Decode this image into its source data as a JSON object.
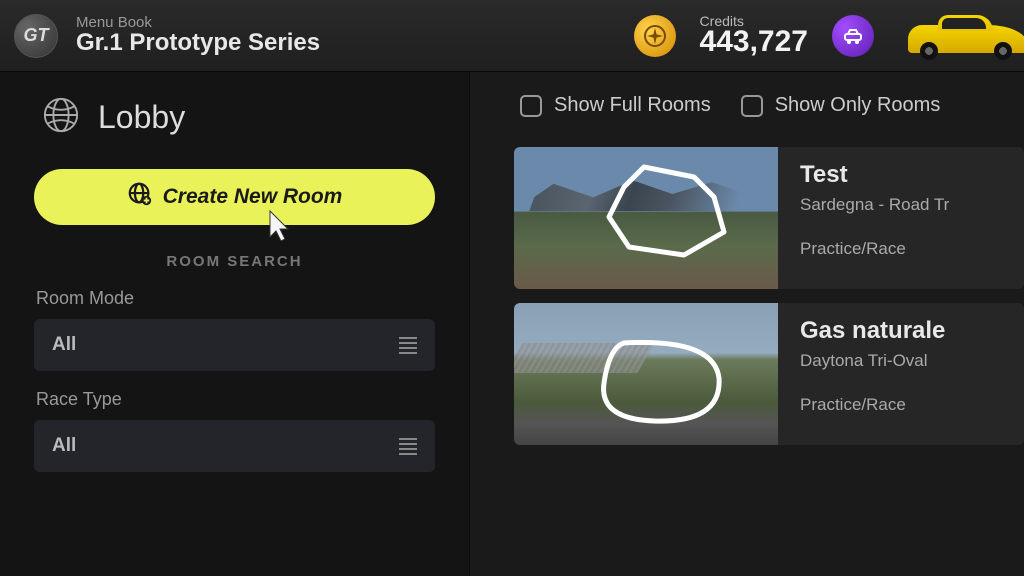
{
  "header": {
    "logo_text": "GT",
    "menu_label": "Menu Book",
    "series_title": "Gr.1 Prototype Series",
    "credits_label": "Credits",
    "credits_value": "443,727"
  },
  "sidebar": {
    "lobby_title": "Lobby",
    "create_button_label": "Create New Room",
    "room_search_heading": "ROOM SEARCH",
    "filters": [
      {
        "label": "Room Mode",
        "value": "All"
      },
      {
        "label": "Race Type",
        "value": "All"
      }
    ]
  },
  "content": {
    "checkboxes": [
      {
        "label": "Show Full Rooms",
        "checked": false
      },
      {
        "label": "Show Only Rooms",
        "checked": false
      }
    ],
    "rooms": [
      {
        "title": "Test",
        "subtitle": "Sardegna - Road Tr",
        "mode": "Practice/Race"
      },
      {
        "title": "Gas naturale",
        "subtitle": "Daytona Tri-Oval",
        "mode": "Practice/Race"
      }
    ]
  }
}
